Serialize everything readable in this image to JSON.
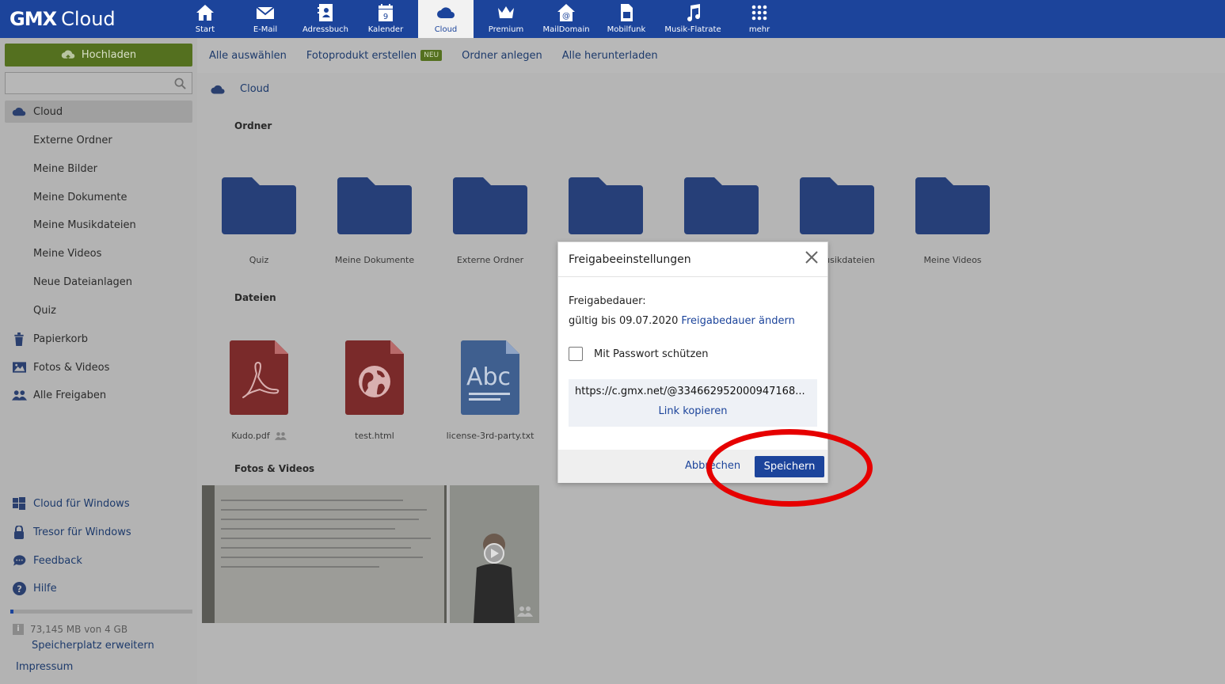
{
  "brand": {
    "name": "GMX",
    "product": "Cloud"
  },
  "nav": [
    {
      "label": "Start",
      "icon": "home-icon"
    },
    {
      "label": "E-Mail",
      "icon": "mail-icon"
    },
    {
      "label": "Adressbuch",
      "icon": "addressbook-icon"
    },
    {
      "label": "Kalender",
      "icon": "calendar-icon",
      "day": "9"
    },
    {
      "label": "Cloud",
      "icon": "cloud-icon",
      "active": true
    },
    {
      "label": "Premium",
      "icon": "crown-icon"
    },
    {
      "label": "MailDomain",
      "icon": "maildomain-icon"
    },
    {
      "label": "Mobilfunk",
      "icon": "simcard-icon"
    },
    {
      "label": "Musik-Flatrate",
      "icon": "music-note-icon"
    },
    {
      "label": "mehr",
      "icon": "grid-icon"
    }
  ],
  "sidebar": {
    "upload_label": "Hochladen",
    "search_placeholder": "",
    "items": [
      {
        "label": "Cloud",
        "icon": "cloud-icon",
        "active": true
      },
      {
        "label": "Externe Ordner"
      },
      {
        "label": "Meine Bilder"
      },
      {
        "label": "Meine Dokumente"
      },
      {
        "label": "Meine Musikdateien"
      },
      {
        "label": "Meine Videos"
      },
      {
        "label": "Neue Dateianlagen"
      },
      {
        "label": "Quiz"
      },
      {
        "label": "Papierkorb",
        "icon": "trash-icon"
      },
      {
        "label": "Fotos & Videos",
        "icon": "photos-icon"
      },
      {
        "label": "Alle Freigaben",
        "icon": "people-icon"
      }
    ],
    "bottom_links": [
      {
        "label": "Cloud für Windows",
        "icon": "windows-icon"
      },
      {
        "label": "Tresor für Windows",
        "icon": "lock-icon"
      },
      {
        "label": "Feedback",
        "icon": "chat-icon"
      },
      {
        "label": "Hilfe",
        "icon": "help-icon"
      }
    ],
    "quota": {
      "text": "73,145 MB von 4 GB",
      "used_fraction": 0.018
    },
    "storage_link": "Speicherplatz erweitern",
    "impressum": "Impressum"
  },
  "toolbar": {
    "select_all": "Alle auswählen",
    "photo_product": "Fotoprodukt erstellen",
    "new_badge": "NEU",
    "new_folder": "Ordner anlegen",
    "download_all": "Alle herunterladen"
  },
  "breadcrumb": "Cloud",
  "sections": {
    "folders": "Ordner",
    "files": "Dateien",
    "photos": "Fotos & Videos"
  },
  "folders": [
    {
      "name": "Quiz"
    },
    {
      "name": "Meine Dokumente"
    },
    {
      "name": "Externe Ordner"
    },
    {
      "name": ""
    },
    {
      "name": ""
    },
    {
      "name": "usikdateien"
    },
    {
      "name": "Meine Videos"
    }
  ],
  "files": [
    {
      "name": "Kudo.pdf",
      "type": "pdf",
      "shared": true
    },
    {
      "name": "test.html",
      "type": "html",
      "shared": false
    },
    {
      "name": "license-3rd-party.txt",
      "type": "txt",
      "shared": false,
      "icon_text": "Abc"
    }
  ],
  "dialog": {
    "title": "Freigabeeinstellungen",
    "duration_label": "Freigabedauer:",
    "valid_until": "gültig bis 09.07.2020",
    "change_duration": "Freigabedauer ändern",
    "password_label": "Mit Passwort schützen",
    "password_checked": false,
    "url": "https://c.gmx.net/@334662952000947168...",
    "copy_link": "Link kopieren",
    "cancel": "Abbrechen",
    "save": "Speichern"
  },
  "colors": {
    "brand_blue": "#1c449b",
    "upload_green": "#54701f",
    "folder_blue": "#263f78",
    "pdf_red": "#7a2a2a",
    "txt_blue": "#3f5f8f",
    "highlight_red": "#e60000"
  }
}
